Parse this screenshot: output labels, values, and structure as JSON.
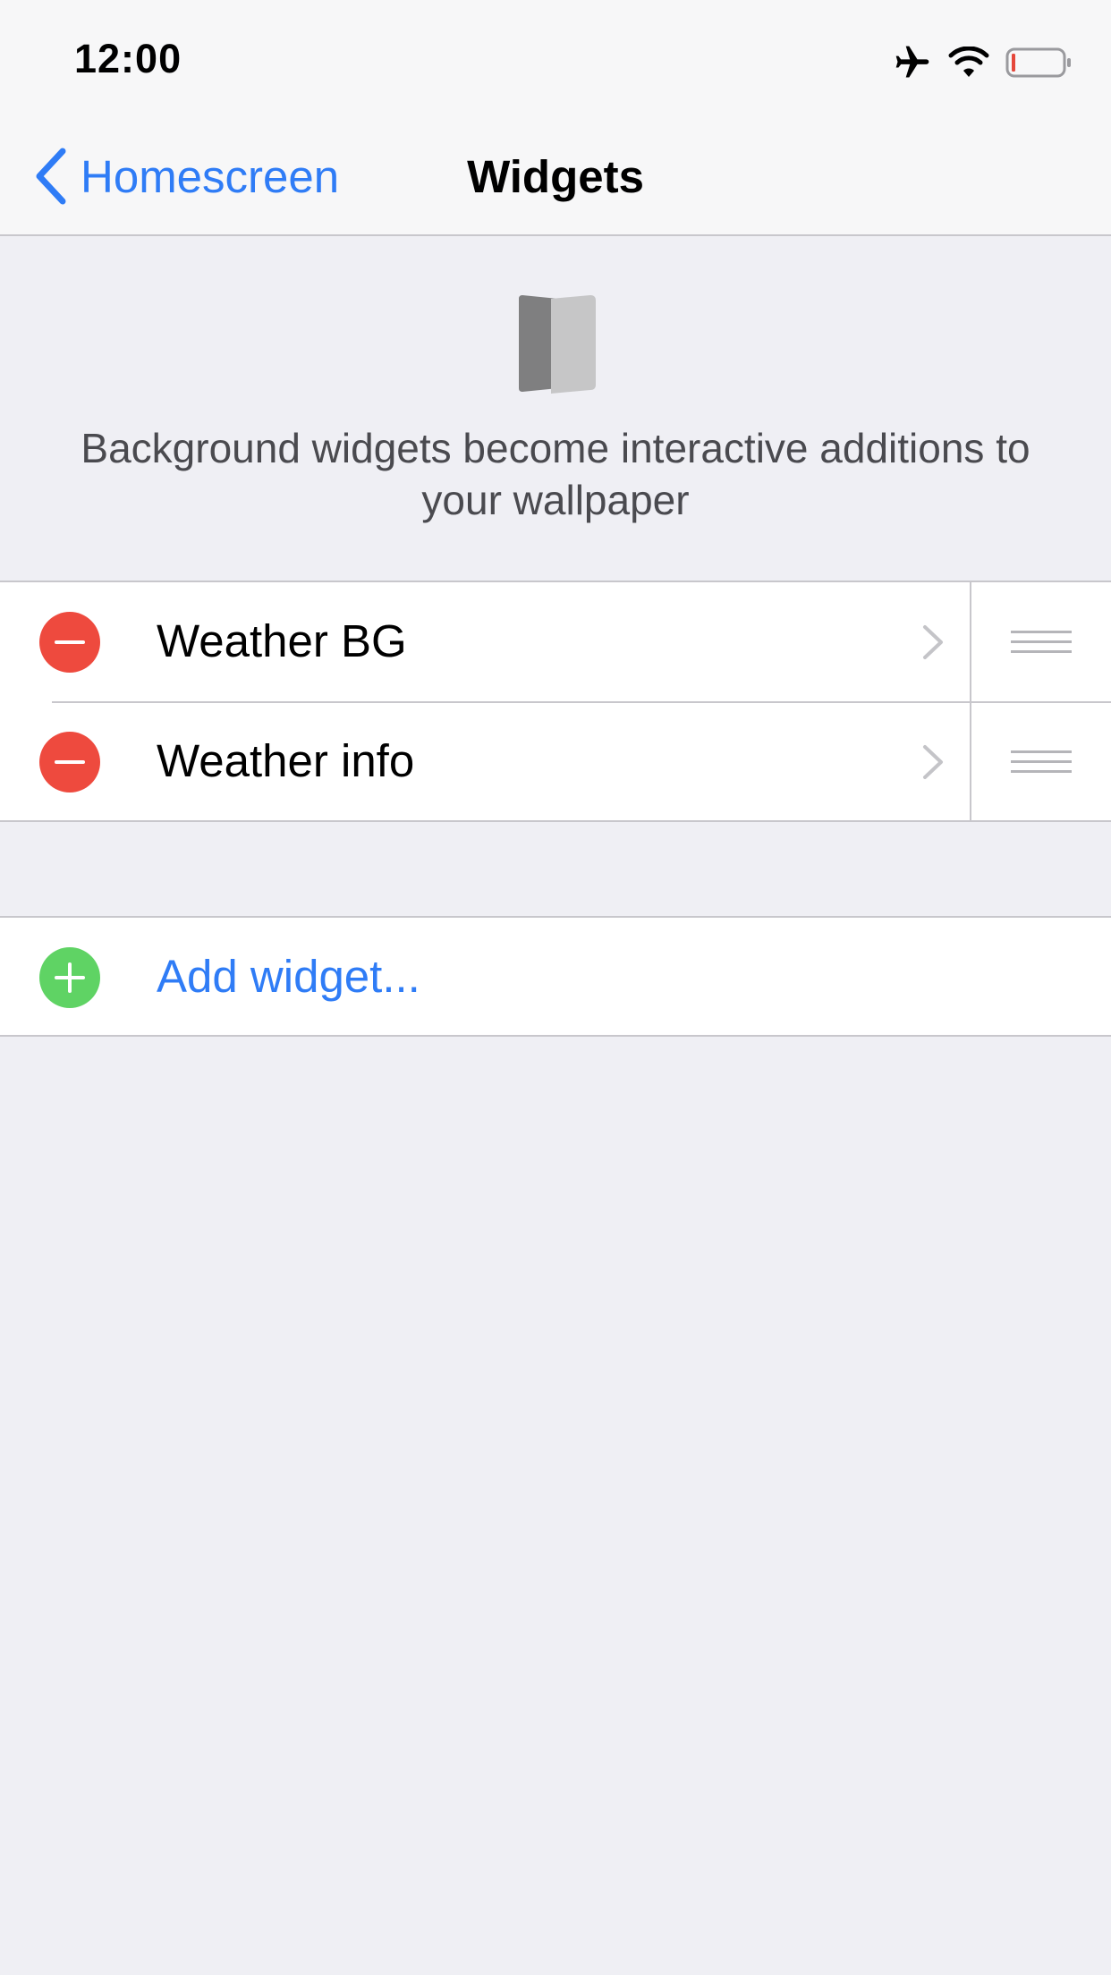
{
  "status_bar": {
    "time": "12:00",
    "icons": [
      "airplane-icon",
      "wifi-icon",
      "battery-icon"
    ],
    "battery_level": 0.05,
    "battery_color": "#e5473b"
  },
  "nav": {
    "back_label": "Homescreen",
    "title": "Widgets"
  },
  "header": {
    "icon": "widget-cards-icon",
    "description": "Background widgets become interactive additions to your wallpaper"
  },
  "widgets": [
    {
      "label": "Weather BG"
    },
    {
      "label": "Weather info"
    }
  ],
  "add_widget": {
    "label": "Add widget..."
  },
  "colors": {
    "accent": "#2f7cf6",
    "delete": "#ee4a3e",
    "add": "#5fd364",
    "background": "#efeff4"
  }
}
